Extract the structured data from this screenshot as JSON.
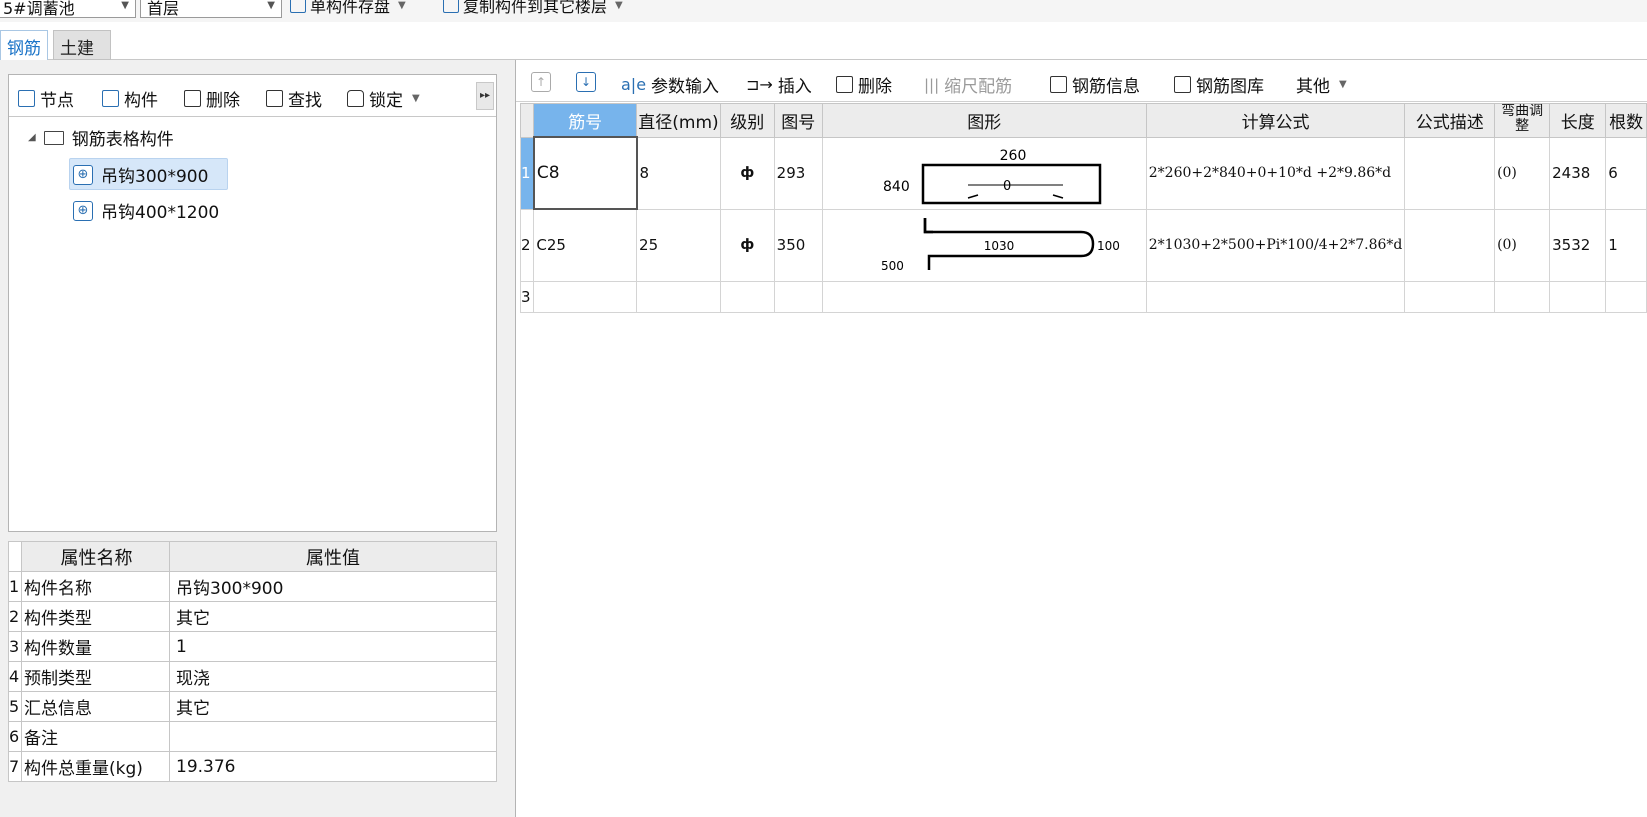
{
  "topbar": {
    "component_combo": "5#调蓄池",
    "floor_combo": "首层",
    "save_single": "单构件存盘",
    "copy_to_floor": "复制构件到其它楼层"
  },
  "tabs": [
    {
      "label": "钢筋",
      "active": true
    },
    {
      "label": "土建",
      "active": false
    }
  ],
  "left_toolbar": {
    "node": "节点",
    "component": "构件",
    "delete": "删除",
    "find": "查找",
    "lock": "锁定"
  },
  "tree": {
    "root": "钢筋表格构件",
    "children": [
      {
        "label": "吊钩300*900",
        "selected": true
      },
      {
        "label": "吊钩400*1200",
        "selected": false
      }
    ]
  },
  "properties": {
    "headers": [
      "属性名称",
      "属性值"
    ],
    "rows": [
      {
        "n": "1",
        "name": "构件名称",
        "value": "吊钩300*900"
      },
      {
        "n": "2",
        "name": "构件类型",
        "value": "其它"
      },
      {
        "n": "3",
        "name": "构件数量",
        "value": "1"
      },
      {
        "n": "4",
        "name": "预制类型",
        "value": "现浇"
      },
      {
        "n": "5",
        "name": "汇总信息",
        "value": "其它"
      },
      {
        "n": "6",
        "name": "备注",
        "value": ""
      },
      {
        "n": "7",
        "name": "构件总重量(kg)",
        "value": "19.376"
      }
    ]
  },
  "right_toolbar": {
    "param_input": "参数输入",
    "insert": "插入",
    "delete": "删除",
    "scale_rebar": "缩尺配筋",
    "rebar_info": "钢筋信息",
    "rebar_library": "钢筋图库",
    "other": "其他"
  },
  "grid": {
    "headers": [
      "筋号",
      "直径(mm)",
      "级别",
      "图号",
      "图形",
      "计算公式",
      "公式描述",
      "弯曲调整",
      "长度",
      "根数"
    ],
    "rows": [
      {
        "n": "1",
        "bar": "C8",
        "dia": "8",
        "grade": "ф",
        "fig": "293",
        "shape": {
          "top": "260",
          "left": "840",
          "mid": "0"
        },
        "formula": "2*260+2*840+0+10*d +2*9.86*d",
        "desc": "",
        "bend": "(0)",
        "length": "2438",
        "count": "6"
      },
      {
        "n": "2",
        "bar": "C25",
        "dia": "25",
        "grade": "ф",
        "fig": "350",
        "shape": {
          "mid": "1030",
          "right": "100",
          "left": "500"
        },
        "formula": "2*1030+2*500+Pi*100/4+2*7.86*d",
        "desc": "",
        "bend": "(0)",
        "length": "3532",
        "count": "1"
      },
      {
        "n": "3"
      }
    ]
  }
}
